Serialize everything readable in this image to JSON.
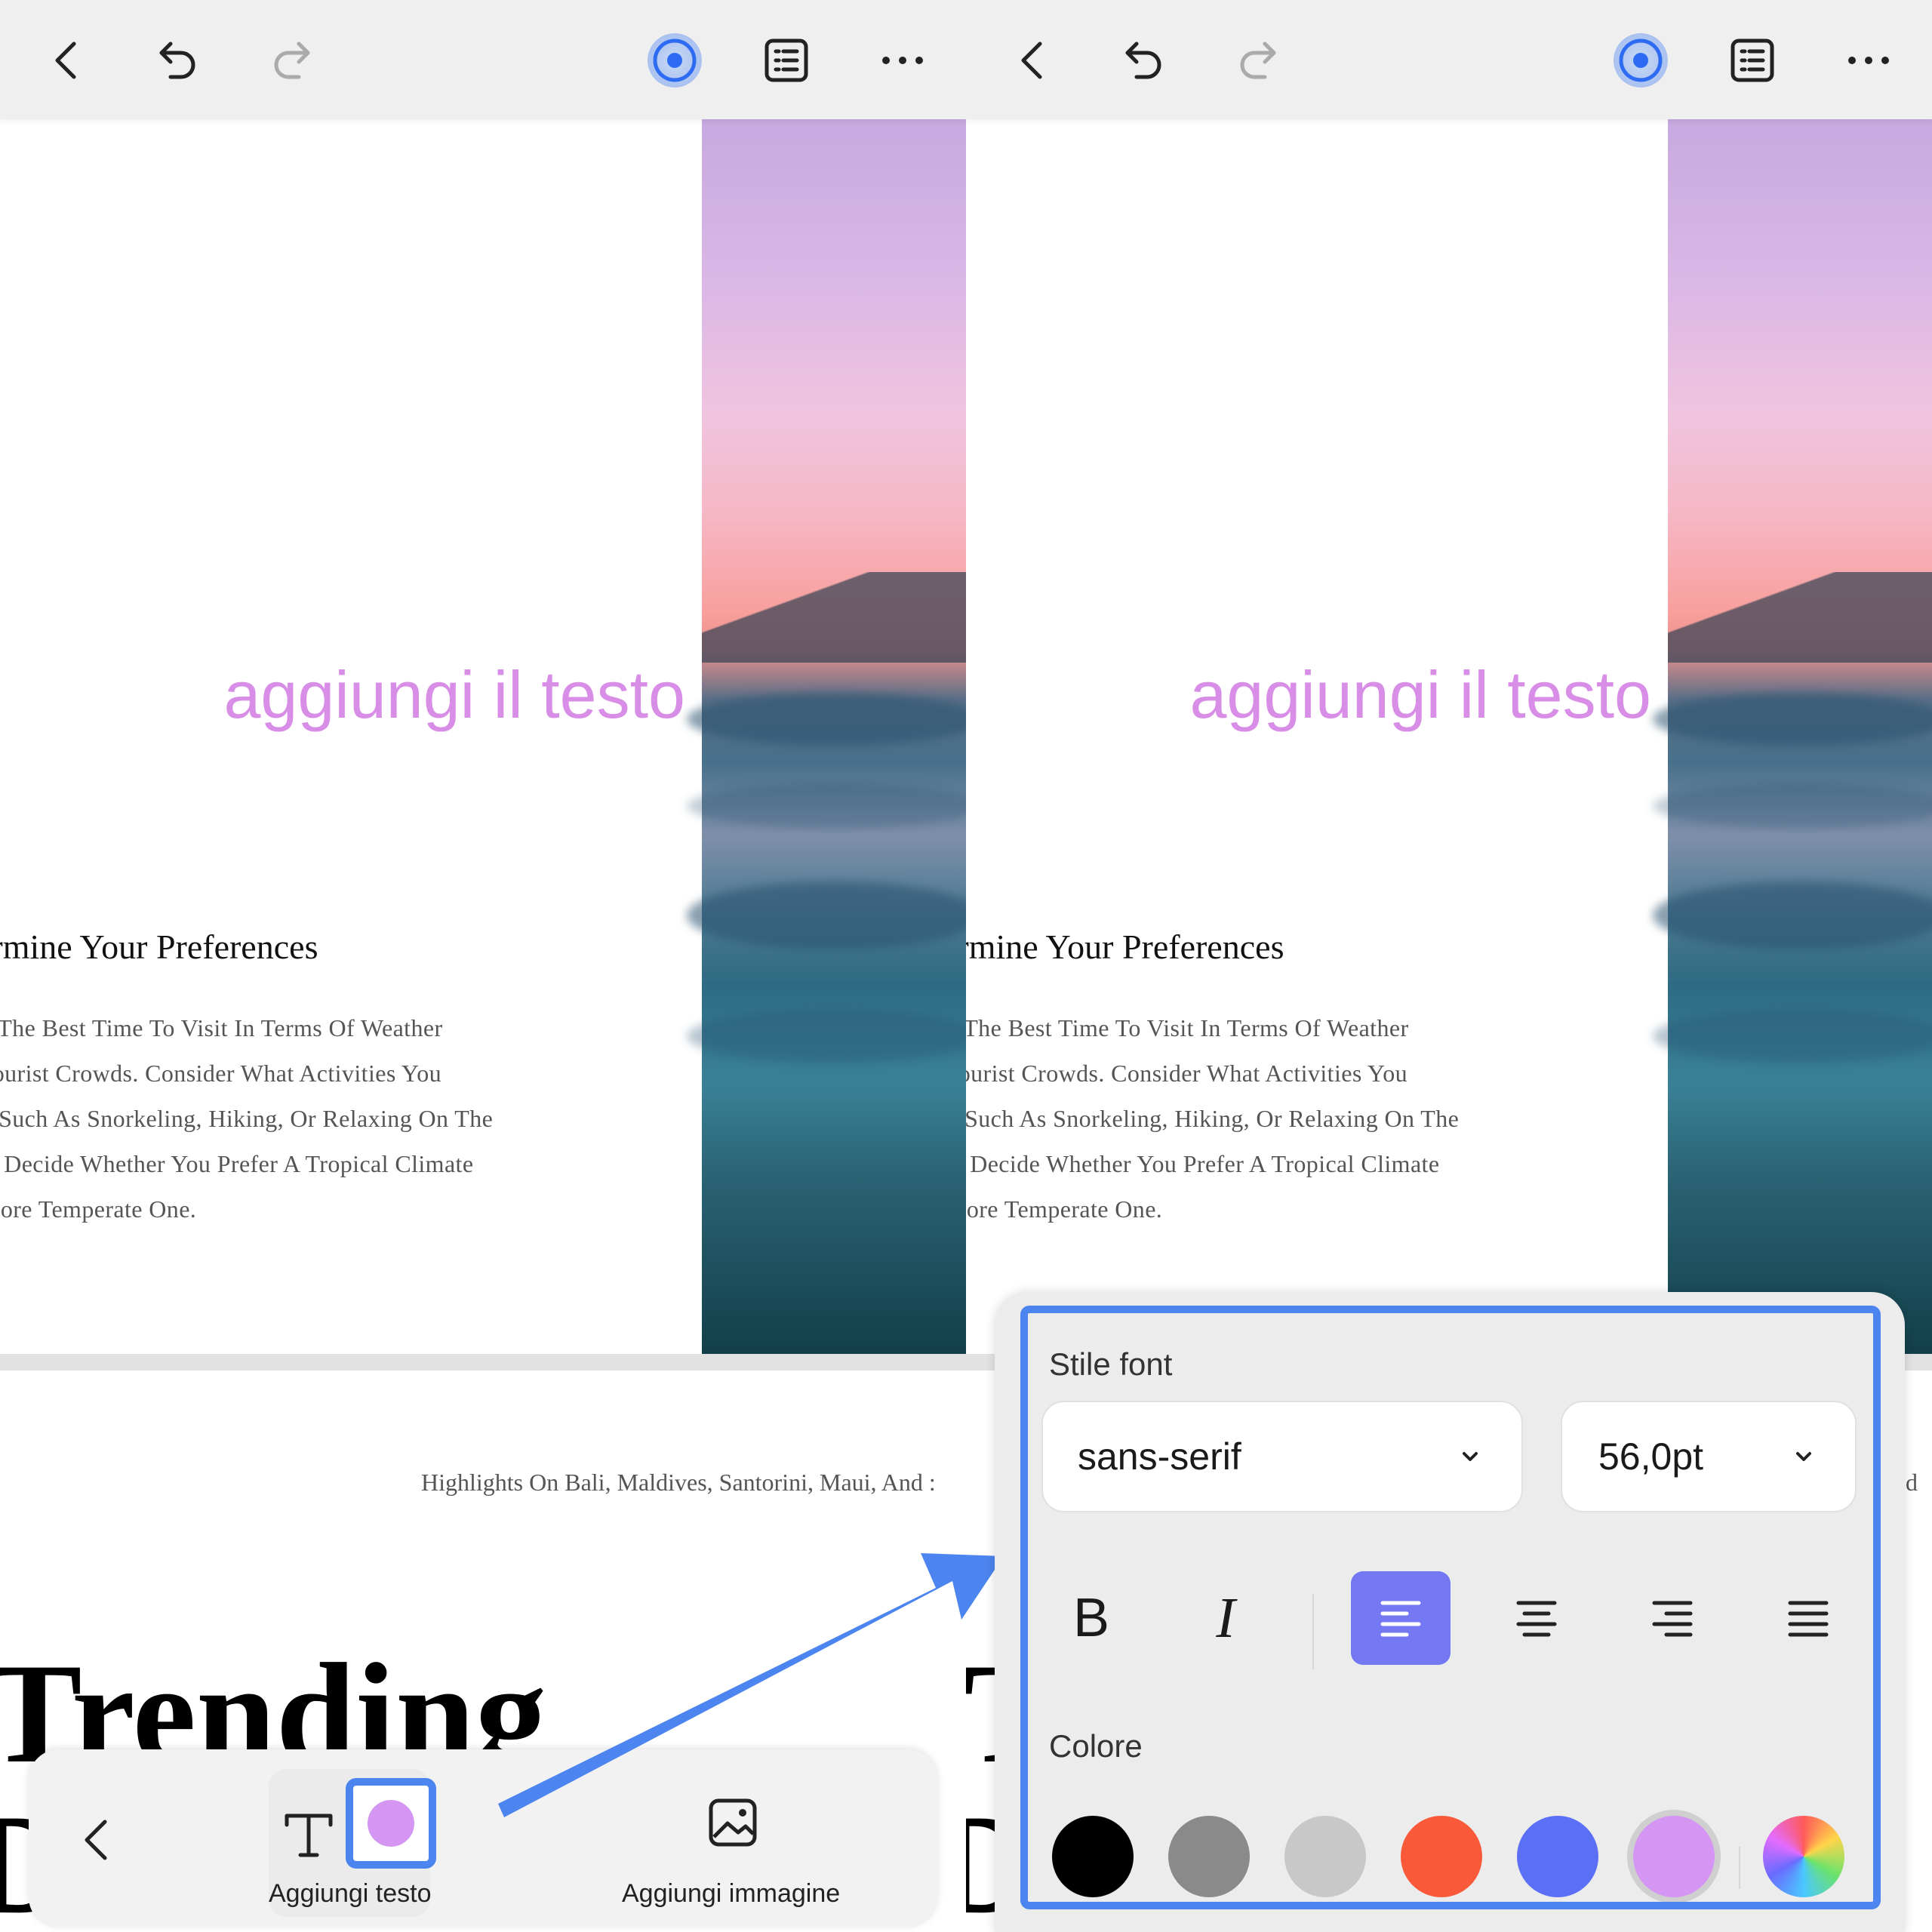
{
  "document": {
    "overlay_text": "aggiungi il testo",
    "heading": "ermine Your Preferences",
    "body_lines": [
      "k The Best Time To Visit In Terms Of Weather",
      "Tourist Crowds. Consider What Activities You",
      "/, Such As Snorkeling, Hiking, Or Relaxing On The",
      "n. Decide Whether You Prefer A Tropical Climate",
      " More Temperate One."
    ],
    "highlights": "Highlights On Bali, Maldives, Santorini, Maui, And :",
    "highlights_right": "d",
    "big_title": "Trending",
    "big_title_right": "T",
    "big_title_2": "D"
  },
  "bottom_bar": {
    "add_text_label": "Aggiungi testo",
    "add_image_label": "Aggiungi immagine",
    "current_color": "#d495f3"
  },
  "font_panel": {
    "font_style_label": "Stile font",
    "font_family_value": "sans-serif",
    "font_size_value": "56,0pt",
    "color_label": "Colore",
    "bold_glyph": "B",
    "italic_glyph": "I",
    "colors": [
      "#000000",
      "#8a8a8a",
      "#c8c8c8",
      "#fb5a3a",
      "#5b6ff7",
      "#d495f3"
    ],
    "selected_color": "#d495f3"
  },
  "theme": {
    "accent": "#4c84f0",
    "overlay_text_color": "#d88ee6",
    "active_align_bg": "#7478f2"
  }
}
